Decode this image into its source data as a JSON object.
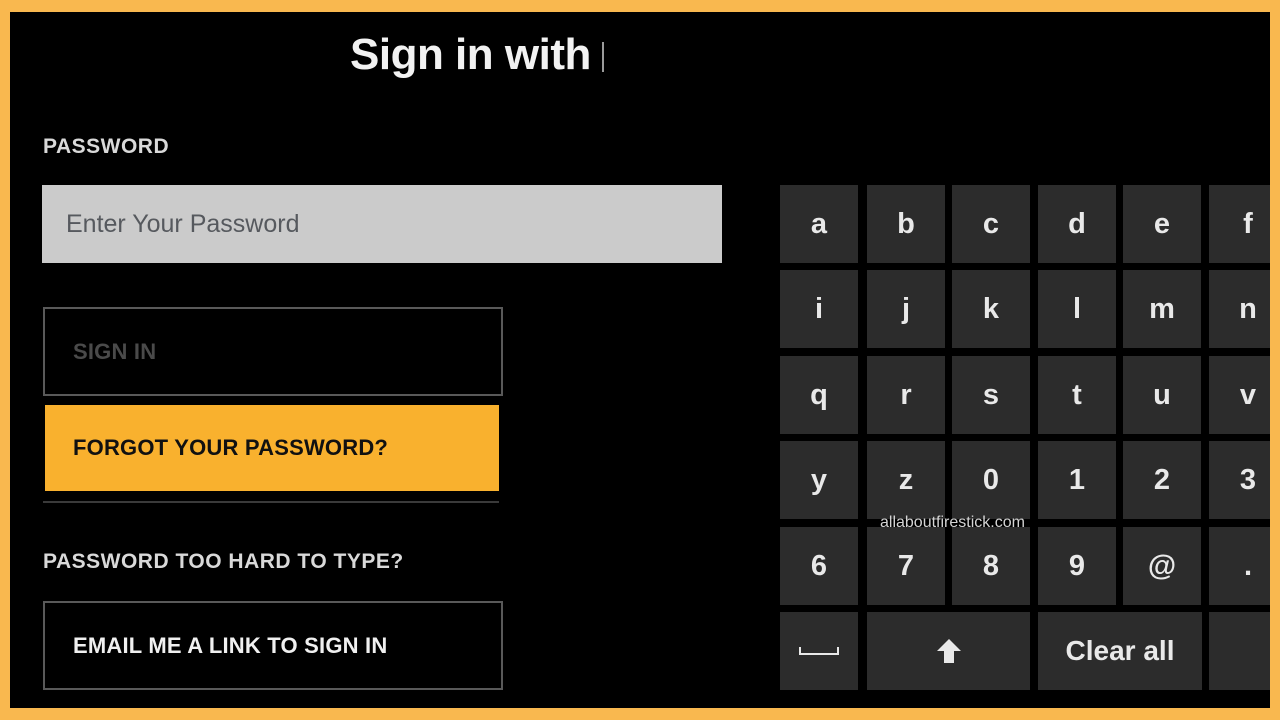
{
  "header": {
    "title": "Sign in with"
  },
  "password": {
    "label": "PASSWORD",
    "placeholder": "Enter Your Password",
    "value": ""
  },
  "buttons": {
    "sign_in": "SIGN IN",
    "forgot": "FORGOT YOUR PASSWORD?",
    "email_link": "EMAIL ME A LINK TO SIGN IN"
  },
  "help": {
    "label": "PASSWORD TOO HARD TO TYPE?"
  },
  "keyboard": {
    "rows": [
      [
        "a",
        "b",
        "c",
        "d",
        "e",
        "f"
      ],
      [
        "i",
        "j",
        "k",
        "l",
        "m",
        "n"
      ],
      [
        "q",
        "r",
        "s",
        "t",
        "u",
        "v"
      ],
      [
        "y",
        "z",
        "0",
        "1",
        "2",
        "3"
      ],
      [
        "6",
        "7",
        "8",
        "9",
        "@",
        "."
      ]
    ],
    "space_icon": "space-bar-icon",
    "shift_icon": "shift-arrow-icon",
    "clear_all": "Clear all"
  },
  "watermark": "allaboutfirestick.com",
  "colors": {
    "frame": "#f9b84f",
    "accent": "#f9b12e",
    "key_bg": "#2c2c2c",
    "input_bg": "#cbcbcb"
  }
}
